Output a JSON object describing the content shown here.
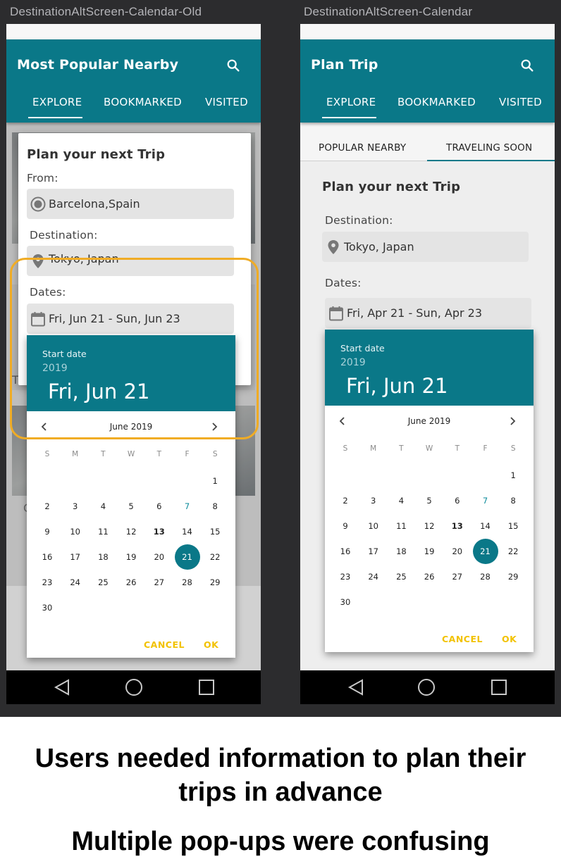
{
  "screens": {
    "left": {
      "label": "DestinationAltScreen-Calendar-Old",
      "appbar_title": "Most Popular Nearby",
      "tabs": [
        "EXPLORE",
        "BOOKMARKED",
        "VISITED"
      ],
      "dialog": {
        "title": "Plan your next Trip",
        "from_label": "From:",
        "from_value": "Barcelona,Spain",
        "destination_label": "Destination:",
        "destination_value": "Tokyo, Japan",
        "dates_label": "Dates:",
        "dates_value": "Fri, Jun 21 - Sun, Jun 23"
      },
      "bg_fragments": {
        "left_text": "Ti",
        "below_text": "C"
      }
    },
    "right": {
      "label": "DestinationAltScreen-Calendar",
      "appbar_title": "Plan Trip",
      "tabs": [
        "EXPLORE",
        "BOOKMARKED",
        "VISITED"
      ],
      "subtabs": [
        "POPULAR NEARBY",
        "TRAVELING SOON"
      ],
      "panel": {
        "title": "Plan your next Trip",
        "destination_label": "Destination:",
        "destination_value": "Tokyo, Japan",
        "dates_label": "Dates:",
        "dates_value": "Fri, Apr 21 - Sun, Apr 23"
      }
    }
  },
  "date_picker": {
    "header_label": "Start date",
    "year": "2019",
    "selected_date": "Fri, Jun 21",
    "month": "June 2019",
    "weekdays": [
      "S",
      "M",
      "T",
      "W",
      "T",
      "F",
      "S"
    ],
    "first_weekday_index": 6,
    "days_in_month": 30,
    "today": 7,
    "bold_day": 13,
    "selected_day": 21,
    "cancel": "CANCEL",
    "ok": "OK"
  },
  "captions": [
    "Users needed information to plan their trips in advance",
    "Multiple pop-ups were confusing"
  ],
  "colors": {
    "teal": "#0a7888",
    "accent_yellow": "#f2c200",
    "highlight_orange": "#f0ac25",
    "dark_bg": "#2c2c2e"
  }
}
